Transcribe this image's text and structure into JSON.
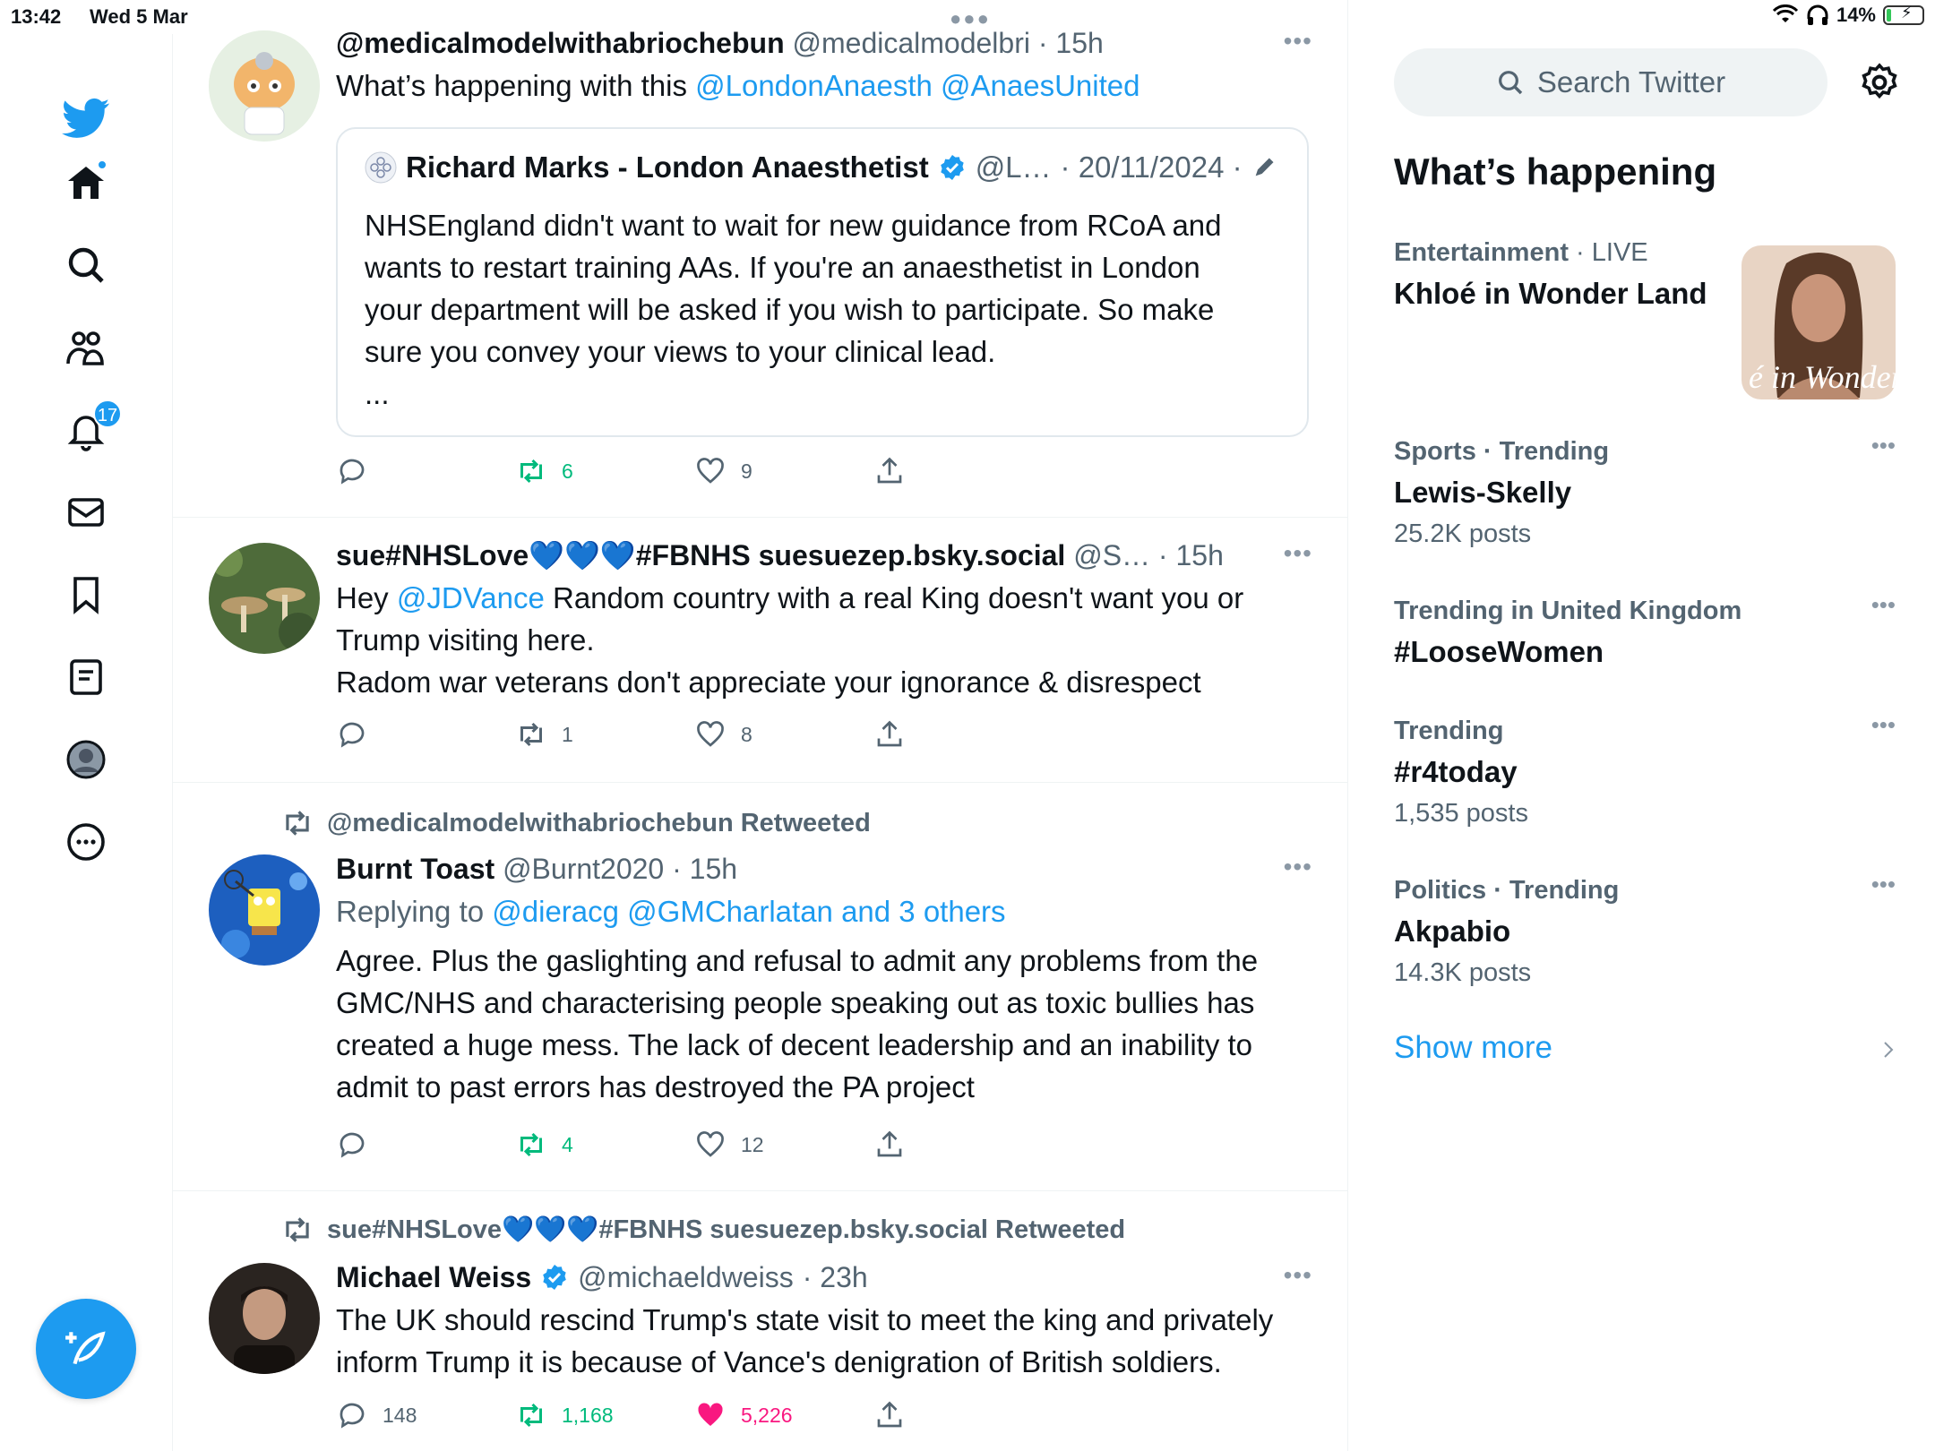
{
  "status_bar": {
    "time": "13:42",
    "date": "Wed 5 Mar",
    "battery": "14%",
    "battery_level_pct": 14
  },
  "nav": {
    "notifications_badge": "17"
  },
  "timeline": {
    "tweets": [
      {
        "name": "@medicalmodelwithabriochebun",
        "handle": "@medicalmodelbri",
        "time": "· 15h",
        "text_prefix": "What’s happening with this ",
        "mention1": "@LondonAnaesth",
        "mention2": "@AnaesUnited",
        "quote": {
          "name": "Richard Marks - London Anaesthetist",
          "handle": "@L…",
          "date": "· 20/11/2024 ·",
          "lines": [
            "NHSEngland didn't want to wait for new guidance from RCoA and",
            "wants to restart training AAs. If you're an anaesthetist in London",
            "your department will be asked if you wish to participate. So make",
            "sure you convey your views to your clinical lead.",
            "..."
          ]
        },
        "retweets": "6",
        "likes": "9"
      },
      {
        "name": "sue#NHSLove💙💙💙#FBNHS suesuezep.bsky.social",
        "handle": "@S…",
        "time": "· 15h",
        "line1_prefix": "Hey ",
        "mention": "@JDVance",
        "line1_rest": " Random country with a real King doesn't want you or",
        "line2": "Trump visiting here.",
        "line3": "Radom war veterans don't appreciate your ignorance & disrespect",
        "retweets": "1",
        "likes": "8"
      },
      {
        "retweeted_by": "@medicalmodelwithabriochebun Retweeted",
        "name": "Burnt Toast",
        "handle": "@Burnt2020",
        "time": "· 15h",
        "replying_to": "Replying to ",
        "reply_mentions": "@dieracg @GMCharlatan and 3 others",
        "lines": [
          "Agree. Plus the gaslighting and refusal to admit any problems from the",
          "GMC/NHS and characterising people speaking out as toxic bullies has",
          "created a huge mess. The lack of decent leadership and an inability to",
          "admit to past errors has destroyed the PA project"
        ],
        "retweets": "4",
        "likes": "12"
      },
      {
        "retweeted_by": "sue#NHSLove💙💙💙#FBNHS suesuezep.bsky.social Retweeted",
        "name": "Michael Weiss",
        "handle": "@michaeldweiss",
        "time": "· 23h",
        "lines": [
          "The UK should rescind Trump's state visit to meet the king and privately",
          "inform Trump it is because of Vance's denigration of British soldiers."
        ],
        "replies": "148",
        "retweets": "1,168",
        "likes": "5,226"
      }
    ]
  },
  "sidebar": {
    "search_placeholder": "Search Twitter",
    "title": "What’s happening",
    "trends": [
      {
        "category": "Entertainment",
        "extra": "· LIVE",
        "title": "Khloé in Wonder Land",
        "image_caption": "é in Wonder I"
      },
      {
        "category": "Sports · Trending",
        "title": "Lewis-Skelly",
        "posts": "25.2K posts"
      },
      {
        "category": "Trending in United Kingdom",
        "title": "#LooseWomen"
      },
      {
        "category": "Trending",
        "title": "#r4today",
        "posts": "1,535 posts"
      },
      {
        "category": "Politics · Trending",
        "title": "Akpabio",
        "posts": "14.3K posts"
      }
    ],
    "show_more": "Show more"
  },
  "colors": {
    "accent": "#1d9bf0",
    "retweet_green": "#00ba7c",
    "like_pink": "#f91880",
    "secondary_text": "#536471"
  }
}
